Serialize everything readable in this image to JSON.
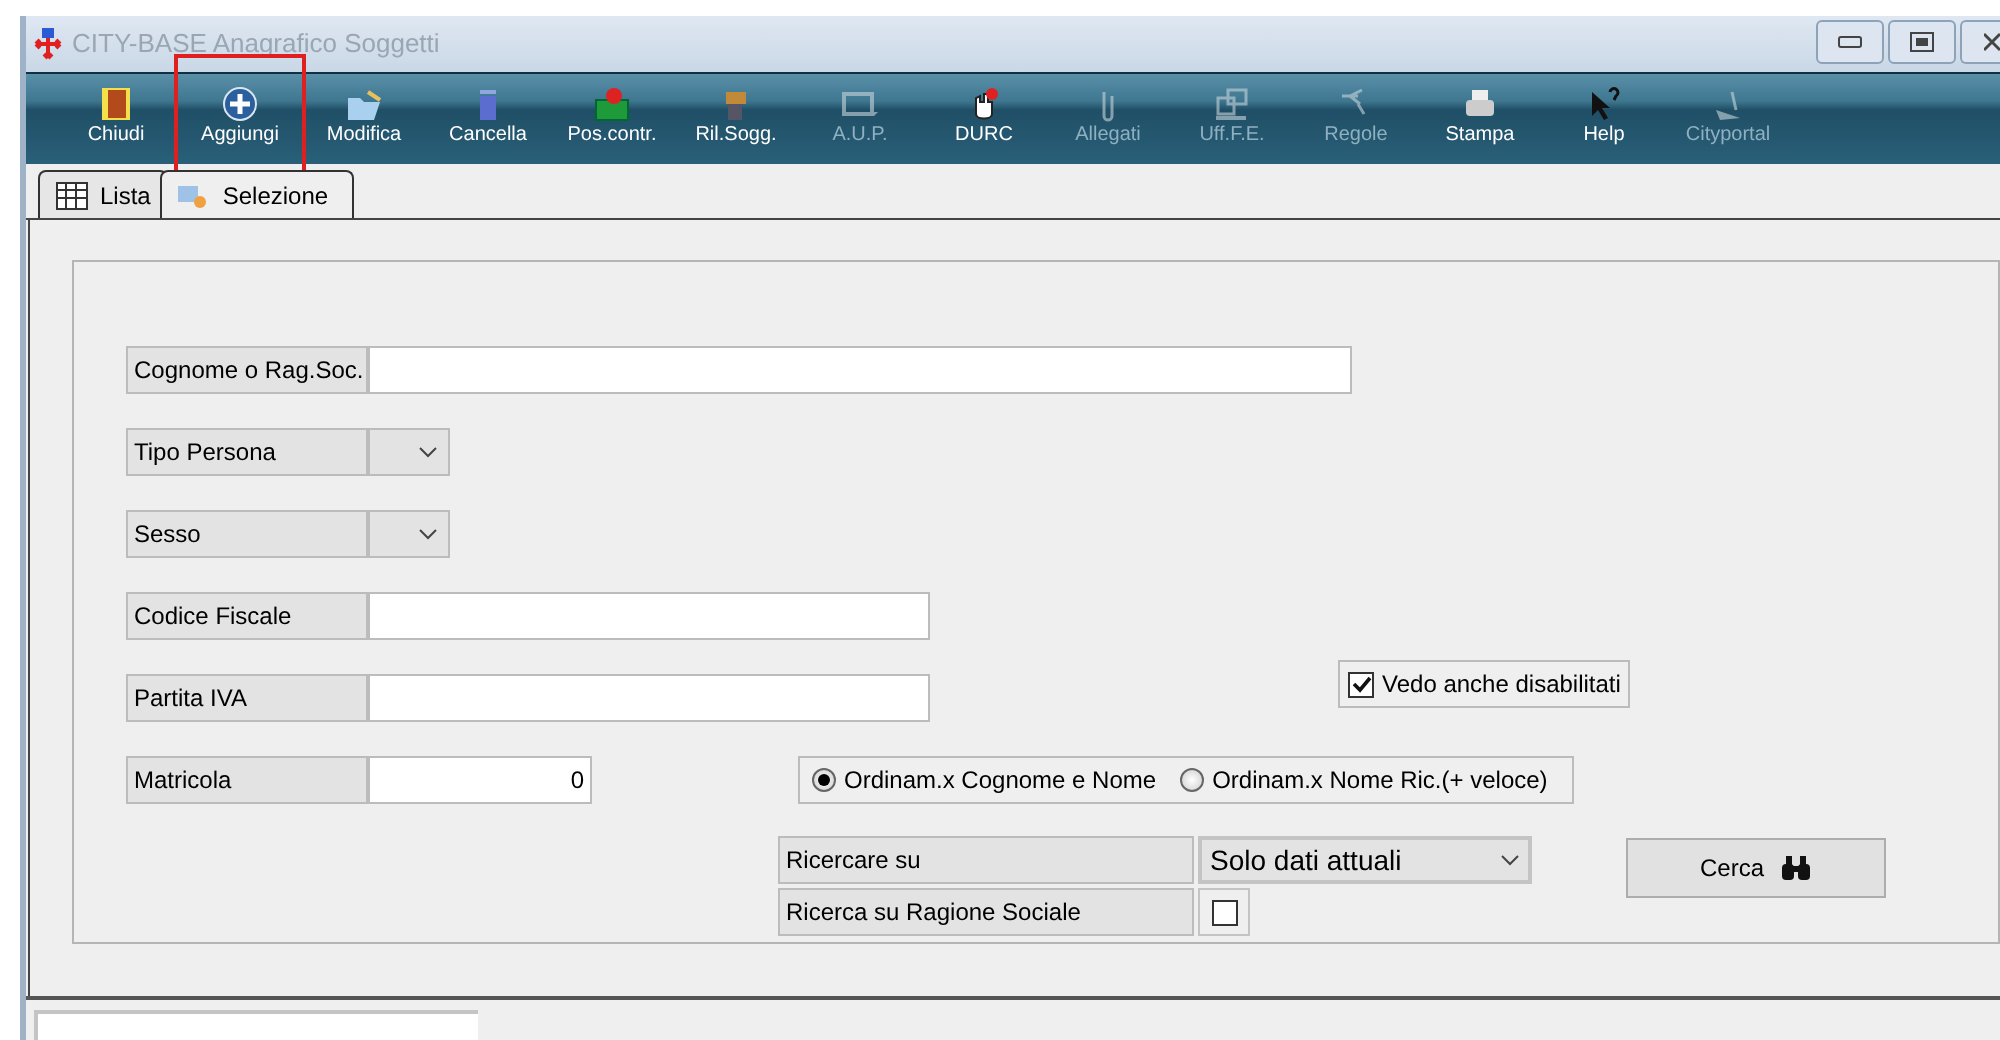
{
  "window": {
    "title": "CITY-BASE Anagrafico Soggetti"
  },
  "toolbar": [
    {
      "label": "Chiudi",
      "disabled": false,
      "highlighted": false
    },
    {
      "label": "Aggiungi",
      "disabled": false,
      "highlighted": true
    },
    {
      "label": "Modifica",
      "disabled": false,
      "highlighted": false
    },
    {
      "label": "Cancella",
      "disabled": false,
      "highlighted": false
    },
    {
      "label": "Pos.contr.",
      "disabled": false,
      "highlighted": false
    },
    {
      "label": "Ril.Sogg.",
      "disabled": false,
      "highlighted": false
    },
    {
      "label": "A.U.P.",
      "disabled": true,
      "highlighted": false
    },
    {
      "label": "DURC",
      "disabled": false,
      "highlighted": false
    },
    {
      "label": "Allegati",
      "disabled": true,
      "highlighted": false
    },
    {
      "label": "Uff.F.E.",
      "disabled": true,
      "highlighted": false
    },
    {
      "label": "Regole",
      "disabled": true,
      "highlighted": false
    },
    {
      "label": "Stampa",
      "disabled": false,
      "highlighted": false
    },
    {
      "label": "Help",
      "disabled": false,
      "highlighted": false
    },
    {
      "label": "Cityportal",
      "disabled": true,
      "highlighted": false
    }
  ],
  "tabs": [
    {
      "label": "Lista",
      "selected": false
    },
    {
      "label": "Selezione",
      "selected": true
    }
  ],
  "form": {
    "fields": [
      {
        "label": "Cognome o Rag.Soc.",
        "kind": "wide_text"
      },
      {
        "label": "Tipo Persona",
        "kind": "select"
      },
      {
        "label": "Sesso",
        "kind": "select"
      },
      {
        "label": "Codice Fiscale",
        "kind": "text"
      },
      {
        "label": "Partita IVA",
        "kind": "text"
      },
      {
        "label": "Matricola",
        "kind": "number",
        "value": "0"
      }
    ],
    "show_disabled": {
      "label": "Vedo anche disabilitati",
      "checked": true
    },
    "order_options": [
      {
        "label": "Ordinam.x Cognome e Nome",
        "selected": true
      },
      {
        "label": "Ordinam.x Nome Ric.(+ veloce)",
        "selected": false
      }
    ],
    "search_on": {
      "label": "Ricercare su",
      "value": "Solo dati attuali"
    },
    "company_search": {
      "label": "Ricerca su Ragione Sociale",
      "checked": false
    },
    "search_button": "Cerca"
  }
}
